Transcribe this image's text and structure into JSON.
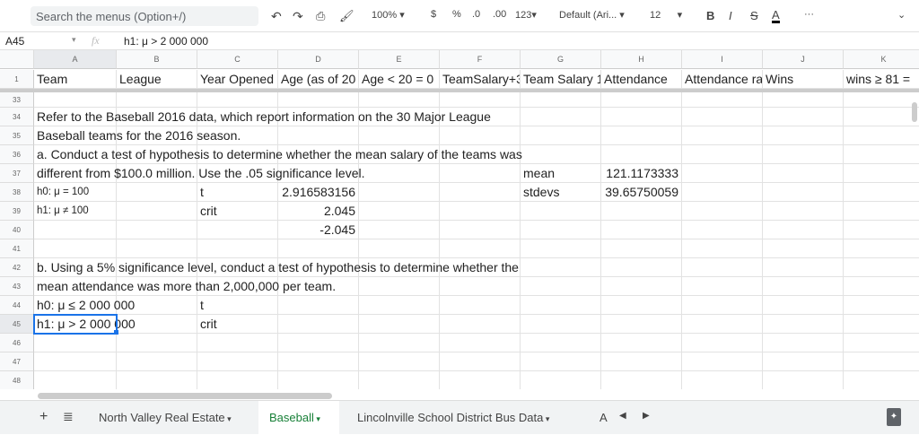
{
  "toolbar": {
    "search_placeholder": "Search the menus (Option+/)",
    "zoom": "100%",
    "currency": "$",
    "percent": "%",
    "dec_less": ".0",
    "dec_more": ".00",
    "format": "123",
    "font": "Default (Ari...",
    "font_size": "12",
    "bold": "B",
    "italic": "I",
    "strike": "S",
    "text_color": "A",
    "more": "···"
  },
  "formula_bar": {
    "cell_ref": "A45",
    "fx": "fx",
    "content": "h1: μ > 2 000 000"
  },
  "columns": [
    "A",
    "B",
    "C",
    "D",
    "E",
    "F",
    "G",
    "H",
    "I",
    "J",
    "K"
  ],
  "header_row": {
    "num": "1",
    "cells": [
      "Team",
      "League",
      "Year Opened",
      "Age (as of 20",
      "Age < 20 = 0",
      "TeamSalary+3",
      "Team Salary 1",
      "Attendance",
      "Attendance ra",
      "Wins",
      "wins ≥ 81 ="
    ]
  },
  "rows": [
    {
      "num": "33",
      "cells": {}
    },
    {
      "num": "34",
      "cells": {
        "A": "Refer to the Baseball 2016 data, which report information on the 30 Major League"
      }
    },
    {
      "num": "35",
      "cells": {
        "A": "Baseball teams for the 2016 season."
      }
    },
    {
      "num": "36",
      "cells": {
        "A": "a. Conduct a test of hypothesis to determine whether the mean salary of the teams was"
      }
    },
    {
      "num": "37",
      "cells": {
        "A": "different from $100.0 million. Use the .05 significance level.",
        "G": "mean",
        "H": "121.1173333"
      }
    },
    {
      "num": "38",
      "cells": {
        "A": "h0: μ = 100",
        "C": "t",
        "D": "2.916583156",
        "G": "stdevs",
        "H": "39.65750059"
      }
    },
    {
      "num": "39",
      "cells": {
        "A": "h1: μ ≠ 100",
        "C": "crit",
        "D": "2.045"
      }
    },
    {
      "num": "40",
      "cells": {
        "D": "-2.045"
      }
    },
    {
      "num": "41",
      "cells": {}
    },
    {
      "num": "42",
      "cells": {
        "A": "b. Using a 5% significance level, conduct a test of hypothesis to determine whether the"
      }
    },
    {
      "num": "43",
      "cells": {
        "A": "mean attendance was more than 2,000,000 per team."
      }
    },
    {
      "num": "44",
      "cells": {
        "A": "h0: μ ≤ 2 000 000",
        "C": "t"
      }
    },
    {
      "num": "45",
      "cells": {
        "A": "h1: μ > 2 000 000",
        "C": "crit"
      }
    },
    {
      "num": "46",
      "cells": {}
    },
    {
      "num": "47",
      "cells": {}
    },
    {
      "num": "48",
      "cells": {}
    }
  ],
  "selected_cell": "A45",
  "sheet_tabs": [
    {
      "label": "North Valley Real Estate",
      "active": false
    },
    {
      "label": "Baseball",
      "active": true
    },
    {
      "label": "Lincolnville School District Bus Data",
      "active": false
    },
    {
      "label": "A",
      "active": false
    }
  ],
  "colors": {
    "accent": "#1a73e8",
    "active_tab": "#188038"
  }
}
